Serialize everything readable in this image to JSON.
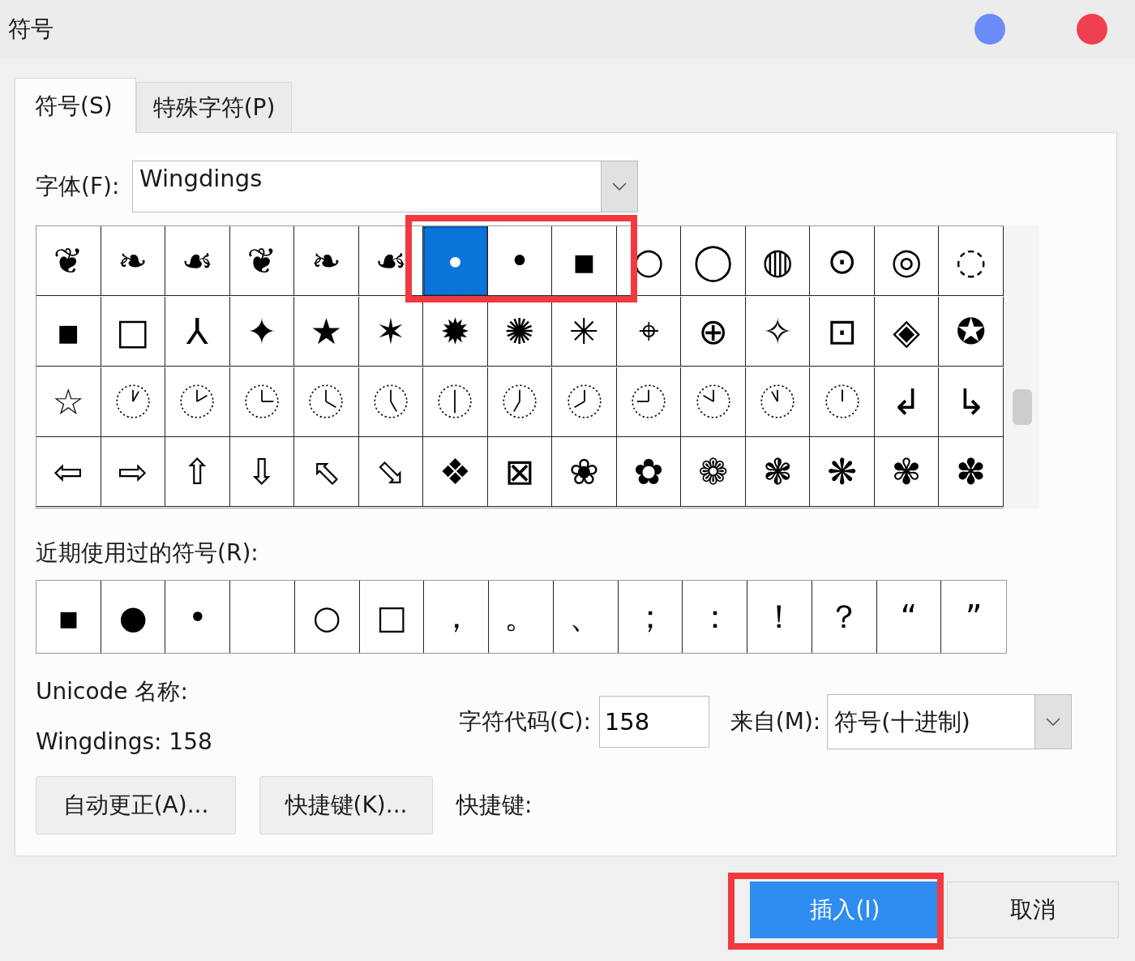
{
  "window": {
    "title": "符号"
  },
  "tabs": [
    {
      "label": "符号(S)",
      "selected": true
    },
    {
      "label": "特殊字符(P)",
      "selected": false
    }
  ],
  "font": {
    "label": "字体(F):",
    "value": "Wingdings"
  },
  "symbol_grid": {
    "cells": [
      {
        "kind": "char",
        "glyph": "❦",
        "selected": false
      },
      {
        "kind": "char",
        "glyph": "❧",
        "selected": false
      },
      {
        "kind": "char",
        "glyph": "☙",
        "selected": false
      },
      {
        "kind": "char",
        "glyph": "❦",
        "selected": false
      },
      {
        "kind": "char",
        "glyph": "❧",
        "selected": false
      },
      {
        "kind": "char",
        "glyph": "☙",
        "selected": false
      },
      {
        "kind": "char",
        "glyph": "∙",
        "selected": true
      },
      {
        "kind": "char",
        "glyph": "•",
        "selected": false
      },
      {
        "kind": "char",
        "glyph": "▪",
        "selected": false
      },
      {
        "kind": "char",
        "glyph": "○",
        "selected": false
      },
      {
        "kind": "char",
        "glyph": "◯",
        "selected": false
      },
      {
        "kind": "char",
        "glyph": "◍",
        "selected": false
      },
      {
        "kind": "char",
        "glyph": "⊙",
        "selected": false
      },
      {
        "kind": "char",
        "glyph": "◎",
        "selected": false
      },
      {
        "kind": "char",
        "glyph": "◌",
        "selected": false
      },
      {
        "kind": "char",
        "glyph": "▪",
        "selected": false
      },
      {
        "kind": "char",
        "glyph": "□",
        "selected": false
      },
      {
        "kind": "char",
        "glyph": "⅄",
        "selected": false
      },
      {
        "kind": "char",
        "glyph": "✦",
        "selected": false
      },
      {
        "kind": "char",
        "glyph": "★",
        "selected": false
      },
      {
        "kind": "char",
        "glyph": "✶",
        "selected": false
      },
      {
        "kind": "char",
        "glyph": "✹",
        "selected": false
      },
      {
        "kind": "char",
        "glyph": "✺",
        "selected": false
      },
      {
        "kind": "char",
        "glyph": "✳",
        "selected": false
      },
      {
        "kind": "char",
        "glyph": "⌖",
        "selected": false
      },
      {
        "kind": "char",
        "glyph": "⊕",
        "selected": false
      },
      {
        "kind": "char",
        "glyph": "✧",
        "selected": false
      },
      {
        "kind": "char",
        "glyph": "⊡",
        "selected": false
      },
      {
        "kind": "char",
        "glyph": "◈",
        "selected": false
      },
      {
        "kind": "char",
        "glyph": "✪",
        "selected": false
      },
      {
        "kind": "char",
        "glyph": "☆",
        "selected": false
      },
      {
        "kind": "clock",
        "selected": false
      },
      {
        "kind": "clock",
        "selected": false
      },
      {
        "kind": "clock",
        "selected": false
      },
      {
        "kind": "clock",
        "selected": false
      },
      {
        "kind": "clock",
        "selected": false
      },
      {
        "kind": "clock",
        "selected": false
      },
      {
        "kind": "clock",
        "selected": false
      },
      {
        "kind": "clock",
        "selected": false
      },
      {
        "kind": "clock",
        "selected": false
      },
      {
        "kind": "clock",
        "selected": false
      },
      {
        "kind": "clock",
        "selected": false
      },
      {
        "kind": "clock",
        "selected": false
      },
      {
        "kind": "char",
        "glyph": "↲",
        "selected": false
      },
      {
        "kind": "char",
        "glyph": "↳",
        "selected": false
      },
      {
        "kind": "char",
        "glyph": "⇦",
        "selected": false
      },
      {
        "kind": "char",
        "glyph": "⇨",
        "selected": false
      },
      {
        "kind": "char",
        "glyph": "⇧",
        "selected": false
      },
      {
        "kind": "char",
        "glyph": "⇩",
        "selected": false
      },
      {
        "kind": "char",
        "glyph": "⬁",
        "selected": false
      },
      {
        "kind": "char",
        "glyph": "⬂",
        "selected": false
      },
      {
        "kind": "char",
        "glyph": "❖",
        "selected": false
      },
      {
        "kind": "char",
        "glyph": "⊠",
        "selected": false
      },
      {
        "kind": "char",
        "glyph": "❀",
        "selected": false
      },
      {
        "kind": "char",
        "glyph": "✿",
        "selected": false
      },
      {
        "kind": "char",
        "glyph": "❁",
        "selected": false
      },
      {
        "kind": "char",
        "glyph": "❃",
        "selected": false
      },
      {
        "kind": "char",
        "glyph": "❋",
        "selected": false
      },
      {
        "kind": "char",
        "glyph": "✾",
        "selected": false
      },
      {
        "kind": "char",
        "glyph": "✽",
        "selected": false
      }
    ]
  },
  "recent": {
    "label": "近期使用过的符号(R):",
    "cells": [
      {
        "kind": "char",
        "glyph": "▪"
      },
      {
        "kind": "char",
        "glyph": "●"
      },
      {
        "kind": "char",
        "glyph": "•"
      },
      {
        "kind": "blank"
      },
      {
        "kind": "char",
        "glyph": "○"
      },
      {
        "kind": "char",
        "glyph": "□"
      },
      {
        "kind": "char",
        "glyph": "，"
      },
      {
        "kind": "char",
        "glyph": "。"
      },
      {
        "kind": "char",
        "glyph": "、"
      },
      {
        "kind": "char",
        "glyph": "；"
      },
      {
        "kind": "char",
        "glyph": "："
      },
      {
        "kind": "char",
        "glyph": "！"
      },
      {
        "kind": "char",
        "glyph": "？"
      },
      {
        "kind": "char",
        "glyph": "“"
      },
      {
        "kind": "char",
        "glyph": "”"
      }
    ]
  },
  "unicode_name": {
    "label": "Unicode 名称:"
  },
  "description": "Wingdings: 158",
  "char_code": {
    "label": "字符代码(C):",
    "value": "158"
  },
  "from": {
    "label": "来自(M):",
    "value": "符号(十进制)"
  },
  "buttons": [
    {
      "label": "自动更正(A)..."
    },
    {
      "label": "快捷键(K)..."
    }
  ],
  "shortcut_label": "快捷键:",
  "dialog_buttons": [
    {
      "label": "插入(I)",
      "kind": "primary"
    },
    {
      "label": "取消",
      "kind": "secondary"
    }
  ]
}
